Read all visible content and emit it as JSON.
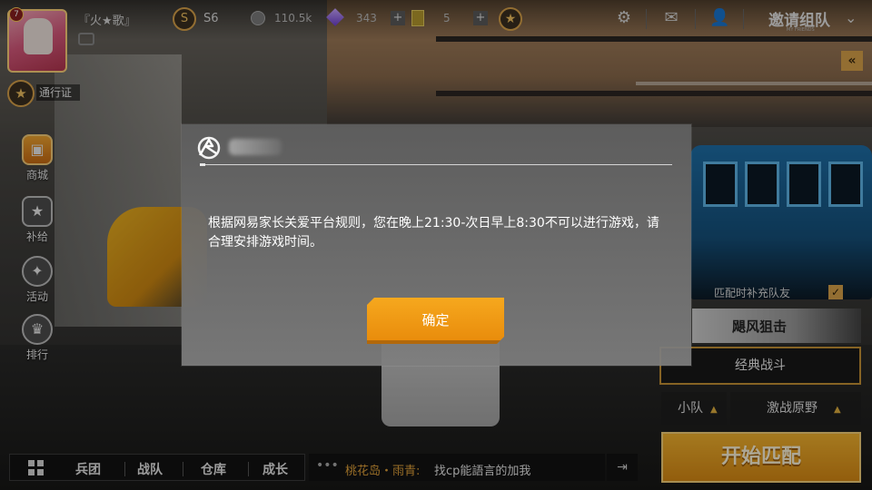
{
  "topbar": {
    "level": "7",
    "player_name": "『火★歌』",
    "rank": "S6",
    "coins": "110.5k",
    "gems": "343",
    "plus": "+",
    "tickets": "5",
    "invite_label": "邀请组队",
    "invite_sub": "MY FRIENDS"
  },
  "left_menu": {
    "pass_label": "通行证",
    "items": [
      {
        "label": "商城",
        "icon": "shop-bag-icon"
      },
      {
        "label": "补给",
        "icon": "supply-icon"
      },
      {
        "label": "活动",
        "icon": "star-event-icon"
      },
      {
        "label": "排行",
        "icon": "ranking-icon"
      }
    ]
  },
  "right_panel": {
    "fill_team_label": "匹配时补充队友",
    "fill_team_checked": true,
    "mode_banner": "飓风狙击",
    "mode_button": "经典战斗",
    "team_select": "小队",
    "map_select": "激战原野",
    "start_button": "开始匹配"
  },
  "bottombar": {
    "nav": [
      "兵团",
      "战队",
      "仓库",
      "成长"
    ],
    "chat_name": "桃花岛・雨青:",
    "chat_text": "找cp能語言的加我"
  },
  "dialog": {
    "message": "根据网易家长关爱平台规则，您在晚上21:30-次日早上8:30不可以进行游戏，请合理安排游戏时间。",
    "ok_label": "确定"
  },
  "colors": {
    "accent_gold": "#d9a24a",
    "confirm_orange": "#f0990f",
    "dialog_bg": "#6f6f6f"
  }
}
